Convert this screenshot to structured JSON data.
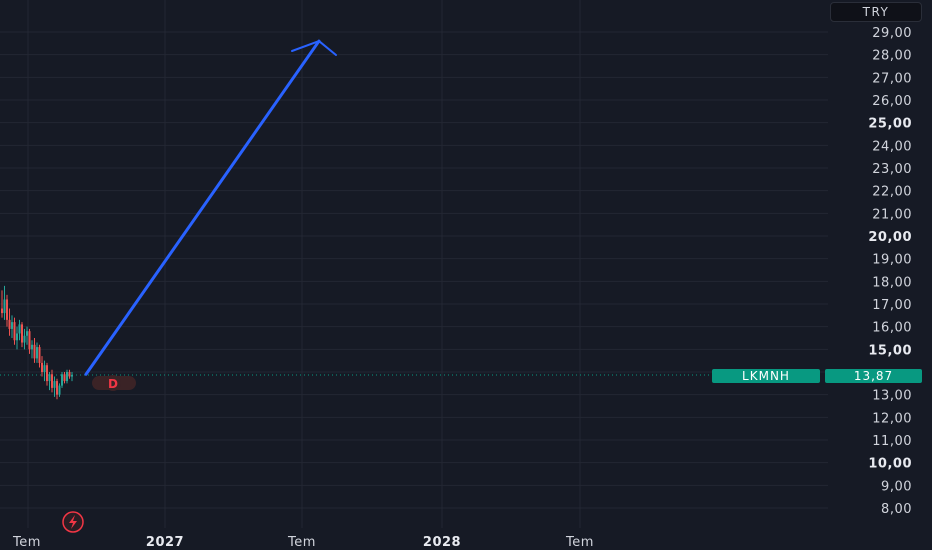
{
  "currency": "TRY",
  "symbol": "LKMNH",
  "last_price": "13,87",
  "colors": {
    "background": "#161a25",
    "grid": "#232733",
    "arrow": "#2962ff",
    "up": "#26a69a",
    "down": "#ef5350",
    "price_line": "#089981",
    "dividend_badge_bg": "#3b2326",
    "dividend_badge_text": "#f23645",
    "flash_badge": "#f23645"
  },
  "chart_data": {
    "type": "candlestick",
    "ylim": [
      7.5,
      29.8
    ],
    "y_ticks": [
      {
        "value": 29,
        "label": "29,00",
        "major": false
      },
      {
        "value": 28,
        "label": "28,00",
        "major": false
      },
      {
        "value": 27,
        "label": "27,00",
        "major": false
      },
      {
        "value": 26,
        "label": "26,00",
        "major": false
      },
      {
        "value": 25,
        "label": "25,00",
        "major": true
      },
      {
        "value": 24,
        "label": "24,00",
        "major": false
      },
      {
        "value": 23,
        "label": "23,00",
        "major": false
      },
      {
        "value": 22,
        "label": "22,00",
        "major": false
      },
      {
        "value": 21,
        "label": "21,00",
        "major": false
      },
      {
        "value": 20,
        "label": "20,00",
        "major": true
      },
      {
        "value": 19,
        "label": "19,00",
        "major": false
      },
      {
        "value": 18,
        "label": "18,00",
        "major": false
      },
      {
        "value": 17,
        "label": "17,00",
        "major": false
      },
      {
        "value": 16,
        "label": "16,00",
        "major": false
      },
      {
        "value": 15,
        "label": "15,00",
        "major": true
      },
      {
        "value": 13,
        "label": "13,00",
        "major": false
      },
      {
        "value": 12,
        "label": "12,00",
        "major": false
      },
      {
        "value": 11,
        "label": "11,00",
        "major": false
      },
      {
        "value": 10,
        "label": "10,00",
        "major": true
      },
      {
        "value": 9,
        "label": "9,00",
        "major": false
      },
      {
        "value": 8,
        "label": "8,00",
        "major": false
      }
    ],
    "x_ticks": [
      {
        "label": "Tem",
        "major": false
      },
      {
        "label": "2027",
        "major": true
      },
      {
        "label": "Tem",
        "major": false
      },
      {
        "label": "2028",
        "major": true
      },
      {
        "label": "Tem",
        "major": false
      }
    ],
    "last_price": 13.87,
    "candles": [
      [
        16.8,
        17.6,
        16.4,
        16.6
      ],
      [
        16.6,
        17.8,
        16.3,
        17.2
      ],
      [
        17.2,
        17.4,
        16.0,
        16.3
      ],
      [
        16.3,
        16.8,
        15.6,
        15.9
      ],
      [
        15.9,
        16.5,
        15.5,
        16.2
      ],
      [
        16.2,
        16.4,
        15.2,
        15.4
      ],
      [
        15.4,
        16.0,
        15.0,
        15.7
      ],
      [
        15.7,
        16.3,
        15.4,
        16.1
      ],
      [
        16.1,
        16.2,
        15.1,
        15.3
      ],
      [
        15.3,
        15.9,
        15.0,
        15.6
      ],
      [
        15.6,
        16.0,
        15.2,
        15.8
      ],
      [
        15.8,
        15.9,
        14.8,
        15.0
      ],
      [
        15.0,
        15.4,
        14.6,
        15.2
      ],
      [
        15.2,
        15.5,
        14.4,
        14.6
      ],
      [
        14.6,
        15.3,
        14.4,
        15.1
      ],
      [
        15.1,
        15.2,
        14.2,
        14.4
      ],
      [
        14.4,
        14.7,
        13.8,
        14.0
      ],
      [
        14.0,
        14.5,
        13.6,
        14.3
      ],
      [
        14.3,
        14.4,
        13.4,
        13.6
      ],
      [
        13.6,
        14.0,
        13.2,
        13.9
      ],
      [
        13.9,
        14.1,
        13.1,
        13.3
      ],
      [
        13.3,
        13.8,
        12.9,
        13.6
      ],
      [
        13.6,
        13.7,
        12.8,
        13.0
      ],
      [
        13.0,
        13.5,
        12.9,
        13.4
      ],
      [
        13.4,
        14.0,
        13.3,
        13.9
      ],
      [
        13.9,
        14.0,
        13.5,
        13.6
      ],
      [
        13.6,
        14.1,
        13.5,
        14.0
      ],
      [
        14.0,
        14.1,
        13.7,
        13.8
      ],
      [
        13.8,
        14.0,
        13.6,
        13.87
      ]
    ],
    "annotations": [
      {
        "type": "arrow",
        "from": {
          "x_index": 29,
          "y": 13.9
        },
        "to": {
          "x_index": 95,
          "y": 28.6
        }
      },
      {
        "type": "dividend_badge",
        "label": "D"
      },
      {
        "type": "event_badge",
        "label": "flash"
      }
    ]
  }
}
